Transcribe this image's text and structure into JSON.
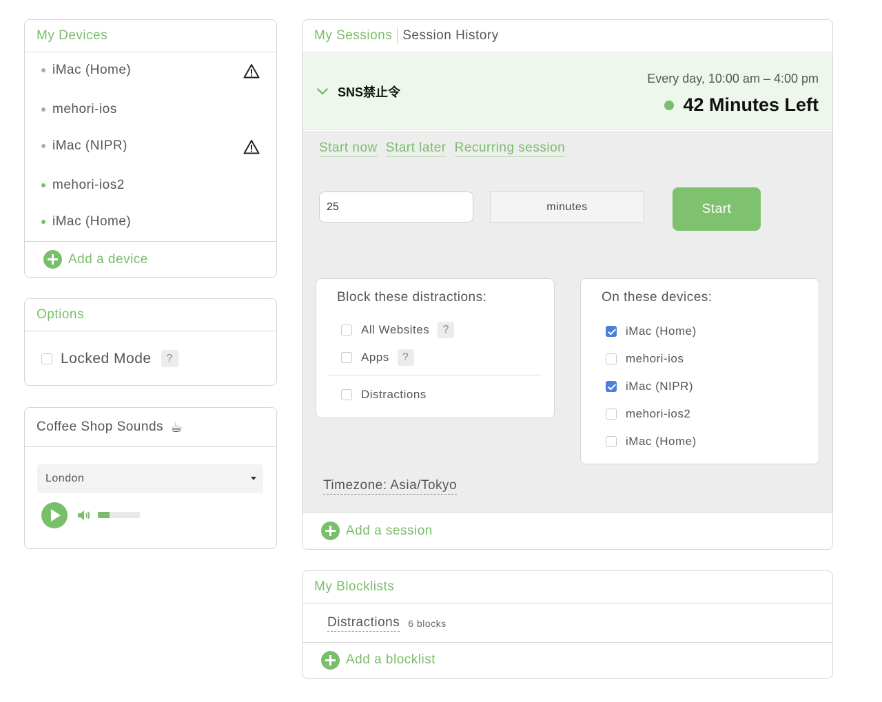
{
  "colors": {
    "accent": "#79be6a",
    "check": "#4a7fde",
    "session_bg": "#eef7ec",
    "body_bg": "#ededed"
  },
  "devices_panel": {
    "title": "My Devices",
    "items": [
      {
        "label": "iMac (Home)",
        "online": false,
        "warning": true
      },
      {
        "label": "mehori-ios",
        "online": false,
        "warning": false
      },
      {
        "label": "iMac (NIPR)",
        "online": false,
        "warning": true
      },
      {
        "label": "mehori-ios2",
        "online": true,
        "warning": false
      },
      {
        "label": "iMac (Home)",
        "online": true,
        "warning": false
      }
    ],
    "add_label": "Add a device"
  },
  "options_panel": {
    "title": "Options",
    "locked_mode_label": "Locked Mode",
    "locked_mode_checked": false,
    "help_label": "?"
  },
  "coffee_panel": {
    "title": "Coffee Shop Sounds",
    "emoji": "☕",
    "selected_city": "London",
    "volume_fraction": 0.28
  },
  "sessions_panel": {
    "tab_active": "My Sessions",
    "tab_other": "Session History",
    "session": {
      "name": "SNS禁止令",
      "schedule": "Every day, 10:00 am – 4:00 pm",
      "time_left": "42 Minutes Left"
    },
    "links": [
      "Start now",
      "Start later",
      "Recurring session"
    ],
    "duration_value": "25",
    "duration_unit": "minutes",
    "start_label": "Start",
    "block_card": {
      "title": "Block these distractions:",
      "items": [
        {
          "label": "All Websites",
          "checked": false,
          "help": "?"
        },
        {
          "label": "Apps",
          "checked": false,
          "help": "?"
        },
        {
          "label": "Distractions",
          "checked": false
        }
      ]
    },
    "devices_card": {
      "title": "On these devices:",
      "items": [
        {
          "label": "iMac (Home)",
          "checked": true
        },
        {
          "label": "mehori-ios",
          "checked": false
        },
        {
          "label": "iMac (NIPR)",
          "checked": true
        },
        {
          "label": "mehori-ios2",
          "checked": false
        },
        {
          "label": "iMac (Home)",
          "checked": false
        }
      ]
    },
    "timezone": "Timezone: Asia/Tokyo",
    "add_label": "Add a session"
  },
  "blocklists_panel": {
    "title": "My Blocklists",
    "items": [
      {
        "name": "Distractions",
        "count": "6 blocks"
      }
    ],
    "add_label": "Add a blocklist"
  }
}
